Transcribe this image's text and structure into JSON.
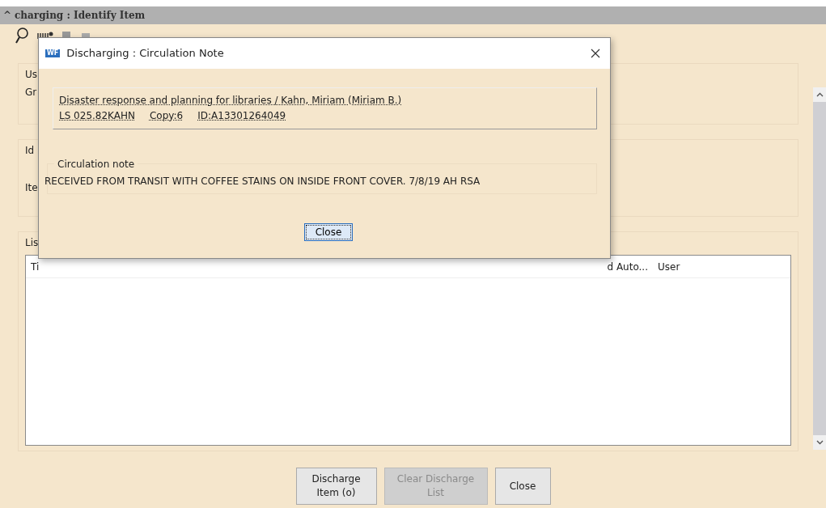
{
  "window": {
    "collapse_glyph": "^",
    "title": "charging : Identify Item"
  },
  "groups": [
    {
      "label": "Us",
      "lines": [
        "Gr"
      ]
    },
    {
      "label": "Id",
      "lines": [
        "Ite"
      ]
    }
  ],
  "list": {
    "label": "Lis",
    "columns": [
      "Ti",
      "d Auto...",
      "User"
    ]
  },
  "buttons": [
    {
      "label": "Discharge Item (o)",
      "disabled": false
    },
    {
      "label": "Clear Discharge List",
      "disabled": true
    },
    {
      "label": "Close",
      "disabled": false
    }
  ],
  "dialog": {
    "app_badge": "WF",
    "title": "Discharging : Circulation Note",
    "item": {
      "title_line": "Disaster response and planning for libraries / Kahn, Miriam (Miriam B.)",
      "call_number": "LS 025.82KAHN",
      "copy": "Copy:6",
      "id": "ID:A13301264049"
    },
    "note": {
      "legend": "Circulation note",
      "text": "RECEIVED FROM TRANSIT WITH COFFEE STAINS ON INSIDE FRONT COVER. 7/8/19 AH RSA"
    },
    "button": {
      "label": "Close",
      "focused": true
    }
  }
}
